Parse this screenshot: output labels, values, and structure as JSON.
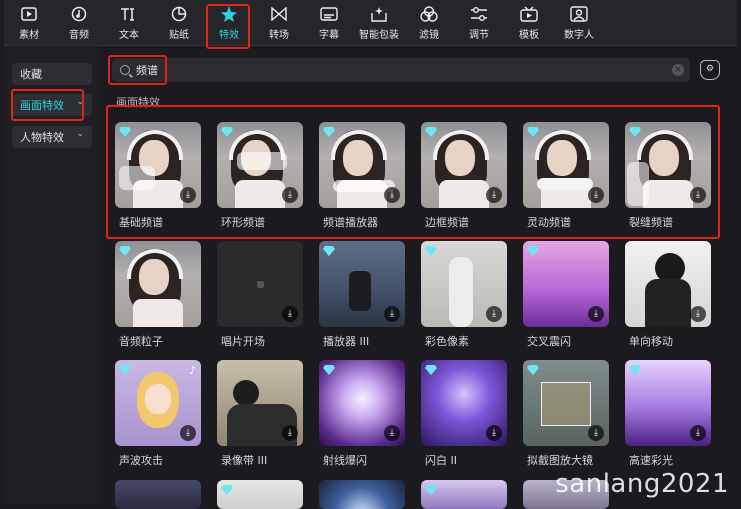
{
  "toolbar": {
    "items": [
      {
        "label": "素材",
        "icon": "media-icon"
      },
      {
        "label": "音频",
        "icon": "audio-icon"
      },
      {
        "label": "文本",
        "icon": "text-icon"
      },
      {
        "label": "贴纸",
        "icon": "sticker-icon"
      },
      {
        "label": "特效",
        "icon": "effects-star-icon",
        "active": true
      },
      {
        "label": "转场",
        "icon": "transition-icon"
      },
      {
        "label": "字幕",
        "icon": "subtitle-icon"
      },
      {
        "label": "智能包装",
        "icon": "smart-pack-icon"
      },
      {
        "label": "滤镜",
        "icon": "filter-icon"
      },
      {
        "label": "调节",
        "icon": "adjust-icon"
      },
      {
        "label": "模板",
        "icon": "template-icon"
      },
      {
        "label": "数字人",
        "icon": "digital-human-icon"
      }
    ]
  },
  "sidebar": {
    "items": [
      {
        "label": "收藏"
      },
      {
        "label": "画面特效",
        "active": true
      },
      {
        "label": "人物特效"
      }
    ]
  },
  "search": {
    "value": "频谱",
    "placeholder": ""
  },
  "section": {
    "title": "画面特效"
  },
  "tiles": [
    {
      "name": "基础频谱",
      "premium": true
    },
    {
      "name": "环形频谱",
      "premium": true
    },
    {
      "name": "频谱播放器",
      "premium": true
    },
    {
      "name": "边框频谱",
      "premium": true
    },
    {
      "name": "灵动频谱",
      "premium": true
    },
    {
      "name": "裂缝频谱",
      "premium": true
    },
    {
      "name": "音频粒子",
      "premium": true
    },
    {
      "name": "唱片开场",
      "premium": false
    },
    {
      "name": "播放器 III",
      "premium": true
    },
    {
      "name": "彩色像素",
      "premium": true
    },
    {
      "name": "交叉震闪",
      "premium": true
    },
    {
      "name": "单向移动",
      "premium": false
    },
    {
      "name": "声波攻击",
      "premium": true,
      "music": true
    },
    {
      "name": "录像带 III",
      "premium": false
    },
    {
      "name": "射线爆闪",
      "premium": true
    },
    {
      "name": "闪白 II",
      "premium": true
    },
    {
      "name": "拟截图放大镜",
      "premium": true
    },
    {
      "name": "高速彩光",
      "premium": true
    }
  ],
  "watermark": "sanlang2021",
  "colors": {
    "accent": "#2cd3e1",
    "highlight_box": "#e2231a",
    "background": "#1b1b1f"
  }
}
